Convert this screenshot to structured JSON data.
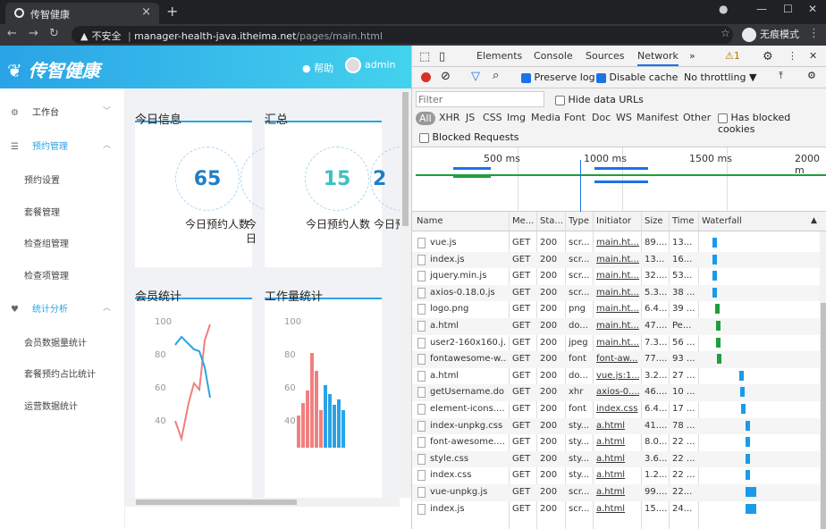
{
  "browser": {
    "tab_title": "传智健康",
    "security_label": "不安全",
    "url_host": "manager-health-java.itheima.net",
    "url_path": "/pages/main.html",
    "incognito_label": "无痕模式"
  },
  "app": {
    "logo": "传智健康",
    "help_label": "帮助",
    "username": "admin",
    "menu": [
      {
        "label": "工作台",
        "icon": "⚙",
        "type": "top",
        "arrow": "﹀"
      },
      {
        "label": "预约管理",
        "icon": "☰",
        "type": "top",
        "arrow": "︿",
        "active": true
      },
      {
        "label": "预约设置",
        "type": "sub"
      },
      {
        "label": "套餐管理",
        "type": "sub"
      },
      {
        "label": "检查组管理",
        "type": "sub"
      },
      {
        "label": "检查项管理",
        "type": "sub"
      },
      {
        "label": "统计分析",
        "icon": "♥",
        "type": "top",
        "arrow": "︿",
        "active": true
      },
      {
        "label": "会员数据量统计",
        "type": "sub"
      },
      {
        "label": "套餐预约占比统计",
        "type": "sub"
      },
      {
        "label": "运营数据统计",
        "type": "sub"
      }
    ],
    "cards": {
      "today_title": "今日信息",
      "summary_title": "汇总",
      "member_title": "会员统计",
      "work_title": "工作量统计",
      "today_value": "65",
      "today_label": "今日预约人数",
      "today_label2": "今日",
      "summary_value": "15",
      "summary_value2": "2",
      "summary_label": "今日预约人数",
      "summary_label2": "今日预"
    },
    "member_chart": {
      "yticks": [
        "100",
        "80",
        "60",
        "40"
      ]
    },
    "work_chart": {
      "yticks": [
        "100",
        "80",
        "60",
        "40"
      ]
    }
  },
  "devtools": {
    "tabs": [
      "Elements",
      "Console",
      "Sources",
      "Network"
    ],
    "selected_tab": "Network",
    "more": "»",
    "warn_count": "1",
    "preserve_log": "Preserve log",
    "disable_cache": "Disable cache",
    "throttle": "No throttling",
    "filter_placeholder": "Filter",
    "hide_data_urls": "Hide data URLs",
    "has_blocked": "Has blocked cookies",
    "blocked_requests": "Blocked Requests",
    "types": [
      "All",
      "XHR",
      "JS",
      "CSS",
      "Img",
      "Media",
      "Font",
      "Doc",
      "WS",
      "Manifest",
      "Other"
    ],
    "ticks": [
      "500 ms",
      "1000 ms",
      "1500 ms",
      "2000 m"
    ],
    "columns": [
      "Name",
      "Me...",
      "Sta...",
      "Type",
      "Initiator",
      "Size",
      "Time",
      "Waterfall"
    ],
    "rows": [
      [
        "vue.js",
        "GET",
        "200",
        "scr...",
        "main.ht...",
        "89....",
        "13...",
        "blue"
      ],
      [
        "index.js",
        "GET",
        "200",
        "scr...",
        "main.ht...",
        "13...",
        "16...",
        "blue"
      ],
      [
        "jquery.min.js",
        "GET",
        "200",
        "scr...",
        "main.ht...",
        "32....",
        "53...",
        "blue"
      ],
      [
        "axios-0.18.0.js",
        "GET",
        "200",
        "scr...",
        "main.ht...",
        "5.3....",
        "38 ...",
        "blue"
      ],
      [
        "logo.png",
        "GET",
        "200",
        "png",
        "main.ht...",
        "6.4....",
        "39 ...",
        "green"
      ],
      [
        "a.html",
        "GET",
        "200",
        "do...",
        "main.ht...",
        "47....",
        "Pe...",
        "green"
      ],
      [
        "user2-160x160.j...",
        "GET",
        "200",
        "jpeg",
        "main.ht...",
        "7.3....",
        "56 ...",
        "green"
      ],
      [
        "fontawesome-w...",
        "GET",
        "200",
        "font",
        "font-aw...",
        "77....",
        "93 ...",
        "green"
      ],
      [
        "a.html",
        "GET",
        "200",
        "do...",
        "vue.js:1...",
        "3.2....",
        "27 ...",
        "blue"
      ],
      [
        "getUsername.do",
        "GET",
        "200",
        "xhr",
        "axios-0....",
        "46....",
        "10 ...",
        "blue"
      ],
      [
        "element-icons....",
        "GET",
        "200",
        "font",
        "index.css",
        "6.4....",
        "17 ...",
        "blue"
      ],
      [
        "index-unpkg.css",
        "GET",
        "200",
        "sty...",
        "a.html",
        "41....",
        "78 ...",
        "blue"
      ],
      [
        "font-awesome....",
        "GET",
        "200",
        "sty...",
        "a.html",
        "8.0....",
        "22 ...",
        "blue"
      ],
      [
        "style.css",
        "GET",
        "200",
        "sty...",
        "a.html",
        "3.6....",
        "22 ...",
        "blue"
      ],
      [
        "index.css",
        "GET",
        "200",
        "sty...",
        "a.html",
        "1.2....",
        "22 ...",
        "blue"
      ],
      [
        "vue-unpkg.js",
        "GET",
        "200",
        "scr...",
        "a.html",
        "99....",
        "22...",
        "blue"
      ],
      [
        "index.js",
        "GET",
        "200",
        "scr...",
        "a.html",
        "15....",
        "24...",
        "blue"
      ]
    ]
  }
}
